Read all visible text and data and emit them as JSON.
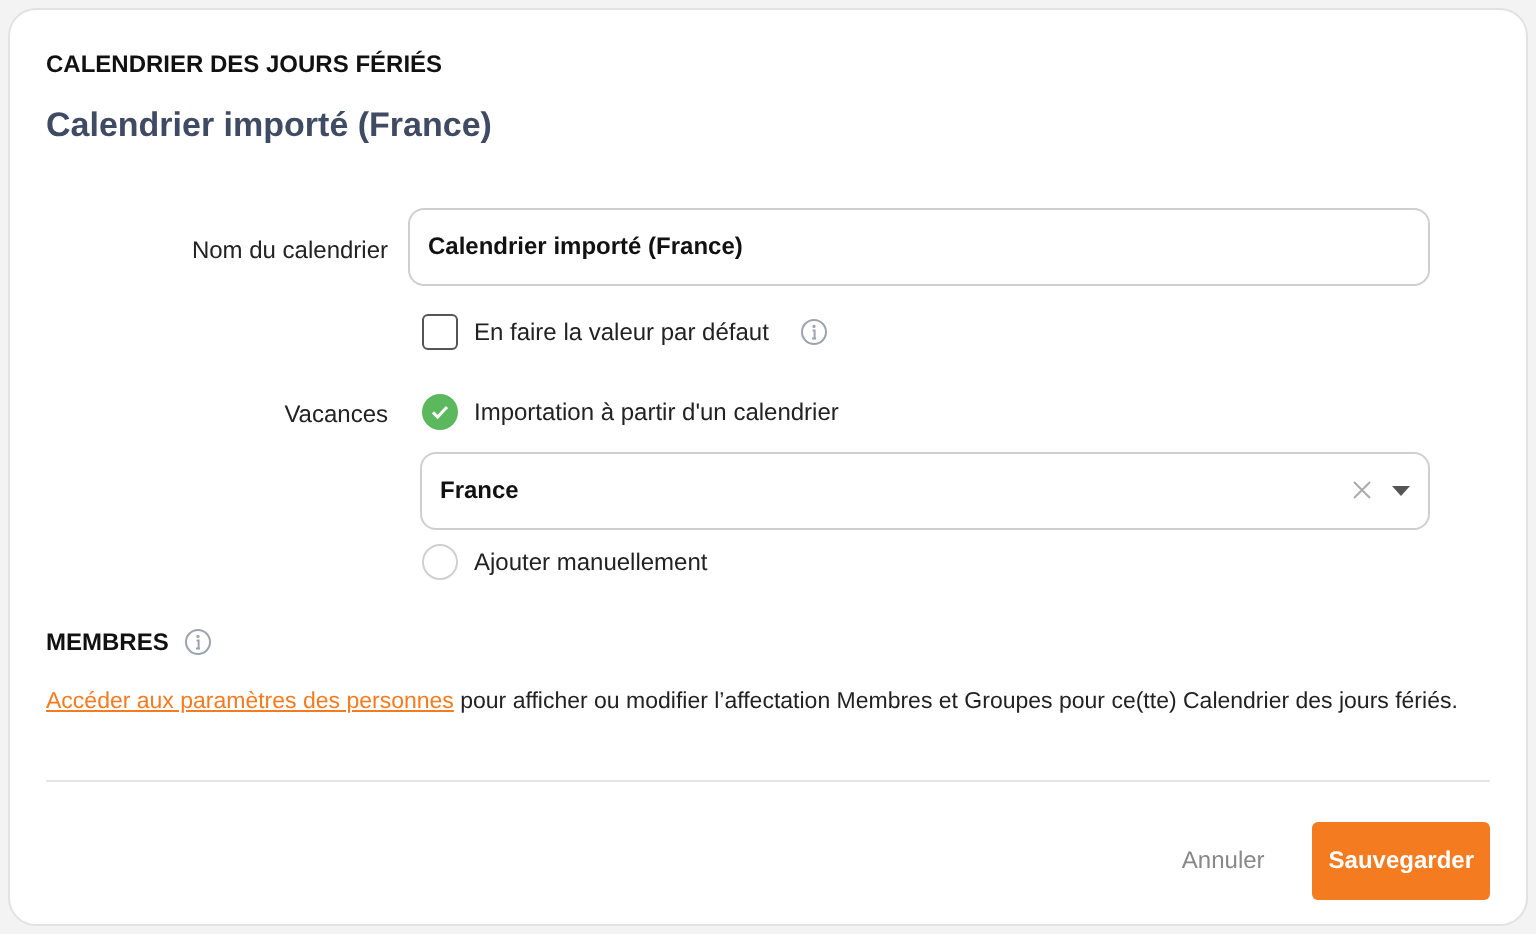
{
  "header": {
    "section": "CALENDRIER DES JOURS FÉRIÉS",
    "title": "Calendrier importé (France)"
  },
  "name_field": {
    "label": "Nom du calendrier",
    "value": "Calendrier importé (France)"
  },
  "default_checkbox": {
    "label": "En faire la valeur par défaut",
    "checked": false
  },
  "holidays": {
    "label": "Vacances",
    "options": [
      {
        "label": "Importation à partir d'un calendrier",
        "selected": true
      },
      {
        "label": "Ajouter manuellement",
        "selected": false
      }
    ],
    "select": {
      "value": "France"
    }
  },
  "members": {
    "title": "MEMBRES",
    "link": "Accéder aux paramètres des personnes",
    "text": "pour afficher ou modifier l’affectation Membres et Groupes pour ce(tte) Calendrier des jours fériés."
  },
  "buttons": {
    "cancel": "Annuler",
    "save": "Sauvegarder"
  }
}
